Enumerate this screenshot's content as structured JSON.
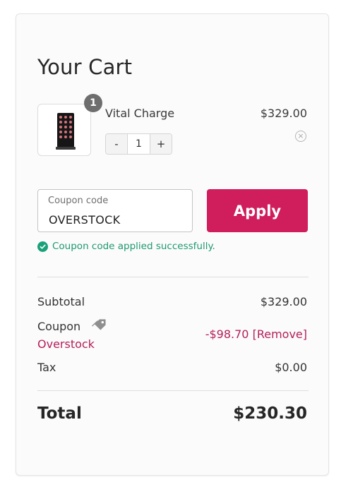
{
  "cart": {
    "title": "Your Cart",
    "item": {
      "quantity_badge": "1",
      "name": "Vital Charge",
      "price": "$329.00",
      "quantity": "1",
      "minus_label": "-",
      "plus_label": "+",
      "remove_icon": "close-circle-icon",
      "image_icon": "device-icon"
    }
  },
  "coupon": {
    "label": "Coupon code",
    "value": "OVERSTOCK",
    "apply_label": "Apply",
    "success_message": "Coupon code applied successfully.",
    "success_icon": "check-circle-icon"
  },
  "summary": {
    "subtotal_label": "Subtotal",
    "subtotal_value": "$329.00",
    "coupon_label": "Coupon",
    "coupon_name": "Overstock",
    "coupon_discount": "-$98.70",
    "coupon_remove": "[Remove]",
    "coupon_icon": "tag-icon",
    "tax_label": "Tax",
    "tax_value": "$0.00",
    "total_label": "Total",
    "total_value": "$230.30"
  },
  "colors": {
    "accent": "#d01d5b",
    "coupon_text": "#b41f5a",
    "success": "#1aa17a",
    "badge": "#6e6e6e"
  }
}
